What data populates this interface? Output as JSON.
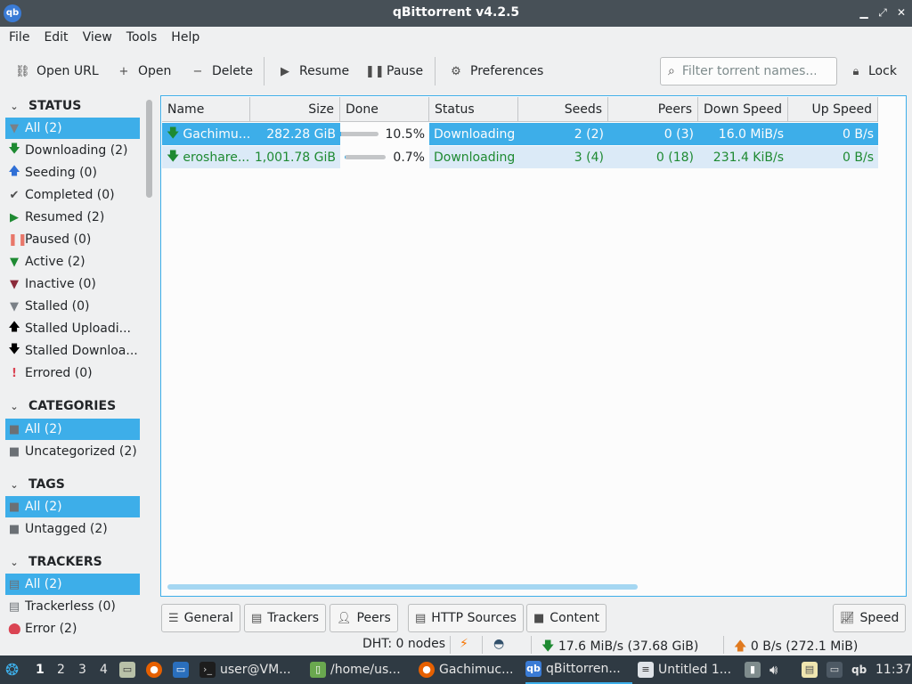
{
  "window": {
    "title": "qBittorrent v4.2.5",
    "icon_text": "qb"
  },
  "menu": [
    "File",
    "Edit",
    "View",
    "Tools",
    "Help"
  ],
  "toolbar": {
    "open_url": "Open URL",
    "open": "Open",
    "delete": "Delete",
    "resume": "Resume",
    "pause": "Pause",
    "preferences": "Preferences",
    "filter_placeholder": "Filter torrent names...",
    "lock": "Lock"
  },
  "sidebar": {
    "status": {
      "heading": "STATUS",
      "items": [
        {
          "label": "All (2)",
          "icon": "filter-icon"
        },
        {
          "label": "Downloading (2)",
          "icon": "down-arrow-icon"
        },
        {
          "label": "Seeding (0)",
          "icon": "up-arrow-icon"
        },
        {
          "label": "Completed (0)",
          "icon": "check-icon"
        },
        {
          "label": "Resumed (2)",
          "icon": "play-icon"
        },
        {
          "label": "Paused (0)",
          "icon": "pause-icon"
        },
        {
          "label": "Active (2)",
          "icon": "filter-icon"
        },
        {
          "label": "Inactive (0)",
          "icon": "filter-icon"
        },
        {
          "label": "Stalled (0)",
          "icon": "filter-icon"
        },
        {
          "label": "Stalled Uploadi...",
          "icon": "up-arrow-icon"
        },
        {
          "label": "Stalled Downloa...",
          "icon": "down-arrow-icon"
        },
        {
          "label": "Errored (0)",
          "icon": "exclamation-icon"
        }
      ]
    },
    "categories": {
      "heading": "CATEGORIES",
      "items": [
        {
          "label": "All (2)"
        },
        {
          "label": "Uncategorized (2)"
        }
      ]
    },
    "tags": {
      "heading": "TAGS",
      "items": [
        {
          "label": "All (2)"
        },
        {
          "label": "Untagged (2)"
        }
      ]
    },
    "trackers": {
      "heading": "TRACKERS",
      "items": [
        {
          "label": "All (2)"
        },
        {
          "label": "Trackerless (0)"
        },
        {
          "label": "Error (2)"
        }
      ]
    }
  },
  "transfer_list": {
    "columns": [
      "Name",
      "Size",
      "Done",
      "Status",
      "Seeds",
      "Peers",
      "Down Speed",
      "Up Speed"
    ],
    "rows": [
      {
        "name": "Gachimu...",
        "size": "282.28 GiB",
        "progress": 0.105,
        "done": "10.5%",
        "status": "Downloading",
        "seeds": "2 (2)",
        "peers": "0 (3)",
        "down_speed": "16.0 MiB/s",
        "up_speed": "0 B/s"
      },
      {
        "name": "eroshare...",
        "size": "1,001.78 GiB",
        "progress": 0.007,
        "done": "0.7%",
        "status": "Downloading",
        "seeds": "3 (4)",
        "peers": "0 (18)",
        "down_speed": "231.4 KiB/s",
        "up_speed": "0 B/s"
      }
    ]
  },
  "properties_tabs": [
    "General",
    "Trackers",
    "Peers",
    "HTTP Sources",
    "Content"
  ],
  "speed_button": "Speed",
  "statusbar": {
    "dht": "DHT: 0 nodes",
    "download": "17.6 MiB/s (37.68 GiB)",
    "upload": "0 B/s (272.1 MiB)"
  },
  "taskbar": {
    "desktops": [
      "1",
      "2",
      "3",
      "4"
    ],
    "tasks": [
      {
        "label": "user@VM...",
        "icon": "terminal-icon"
      },
      {
        "label": "/home/us...",
        "icon": "folder-icon"
      },
      {
        "label": "Gachimuc...",
        "icon": "firefox-icon"
      },
      {
        "label": "qBittorren...",
        "icon": "qbittorrent-icon"
      },
      {
        "label": "Untitled 1...",
        "icon": "document-icon"
      }
    ],
    "clock": "11:37",
    "tray_qb": "qb"
  },
  "colors": {
    "accent": "#3daee9",
    "green": "#1e8a32",
    "titlebar": "#475057",
    "taskbar": "#2f3a43"
  }
}
